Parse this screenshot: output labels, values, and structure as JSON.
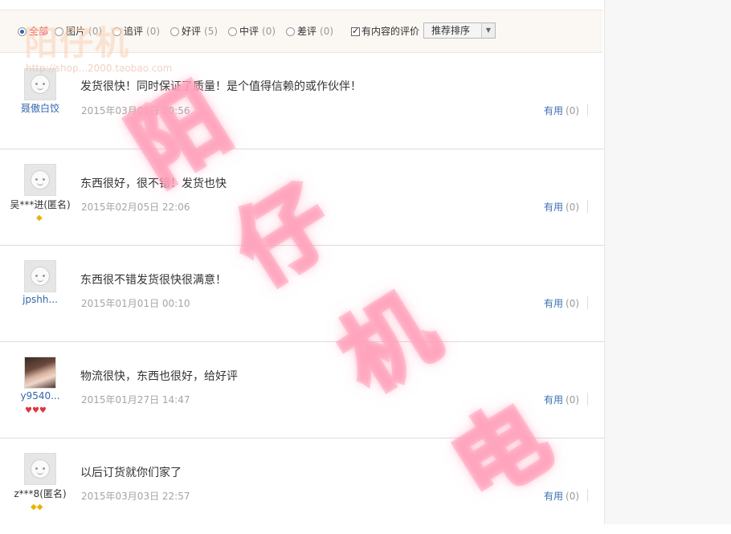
{
  "filters": {
    "options": [
      {
        "label": "全部",
        "count": "",
        "selected": true
      },
      {
        "label": "图片",
        "count": "(0)",
        "selected": false
      },
      {
        "label": "追评",
        "count": "(0)",
        "selected": false
      },
      {
        "label": "好评",
        "count": "(5)",
        "selected": false
      },
      {
        "label": "中评",
        "count": "(0)",
        "selected": false
      },
      {
        "label": "差评",
        "count": "(0)",
        "selected": false
      }
    ],
    "with_content_label": "有内容的评价",
    "with_content_checked": true,
    "sort_value": "推荐排序"
  },
  "reviews": [
    {
      "user": "聂傲白饺",
      "badge": "",
      "badge_color": "",
      "text": "发货很快！同时保证了质量！是个值得信赖的或作伙伴！",
      "date": "2015年03月01日 20:56",
      "useful_label": "有用",
      "useful_count": "(0)"
    },
    {
      "user": "吴***进(匿名)",
      "badge": "◆",
      "badge_color": "gold",
      "text": "东西很好，很不错！发货也快",
      "date": "2015年02月05日 22:06",
      "useful_label": "有用",
      "useful_count": "(0)"
    },
    {
      "user": "jpshh...",
      "badge": "",
      "badge_color": "",
      "text": "东西很不错发货很快很满意！",
      "date": "2015年01月01日 00:10",
      "useful_label": "有用",
      "useful_count": "(0)"
    },
    {
      "user": "y9540...",
      "badge": "♥♥♥",
      "badge_color": "red",
      "text": "物流很快，东西也很好，给好评",
      "date": "2015年01月27日 14:47",
      "useful_label": "有用",
      "useful_count": "(0)"
    },
    {
      "user": "z***8(匿名)",
      "badge": "◆◆",
      "badge_color": "gold",
      "text": "以后订货就你们家了",
      "date": "2015年03月03日 22:57",
      "useful_label": "有用",
      "useful_count": "(0)"
    }
  ],
  "watermark": {
    "top_text": "阳仔机",
    "url": "http://shop...2000.taobao.com",
    "chars": [
      "阳",
      "仔",
      "机",
      "电"
    ]
  }
}
